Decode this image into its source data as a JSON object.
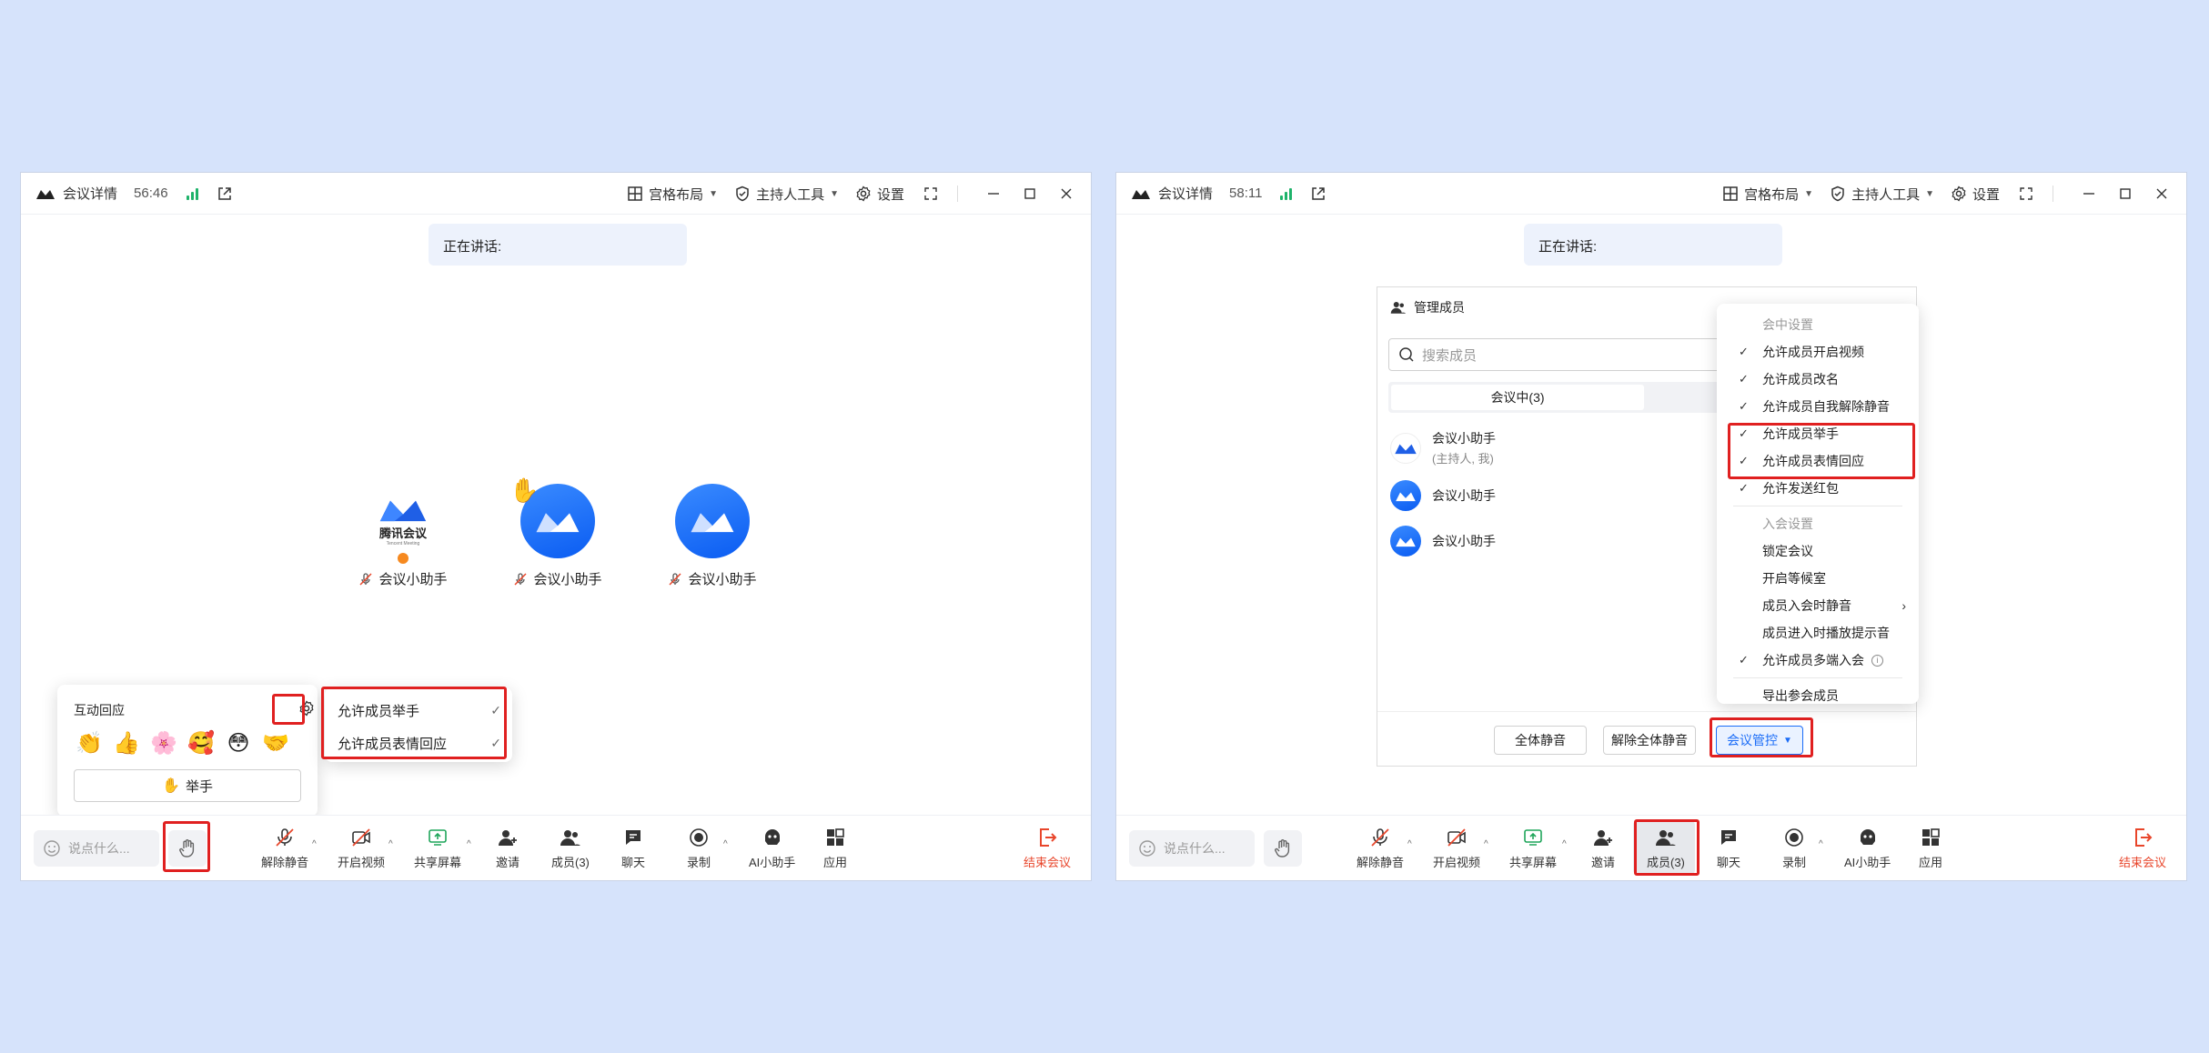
{
  "left": {
    "title": "会议详情",
    "timer": "56:46",
    "grid_layout": "宫格布局",
    "host_tools": "主持人工具",
    "settings": "设置",
    "speaking_label": "正在讲话:",
    "participants": [
      {
        "name": "会议小助手",
        "logo_text": "腾讯会议",
        "logo_sub": "Tencent Meeting"
      },
      {
        "name": "会议小助手"
      },
      {
        "name": "会议小助手"
      }
    ],
    "reactions_title": "互动回应",
    "emojis": [
      "👏",
      "👍",
      "🌸",
      "🥰",
      "😳",
      "🤝"
    ],
    "raise_hand": "举手",
    "settings_menu": [
      "允许成员举手",
      "允许成员表情回应"
    ],
    "chat_placeholder": "说点什么...",
    "toolbar": {
      "unmute": "解除静音",
      "video": "开启视频",
      "share": "共享屏幕",
      "invite": "邀请",
      "members": "成员(3)",
      "chat": "聊天",
      "record": "录制",
      "ai": "AI小助手",
      "apps": "应用",
      "end": "结束会议"
    }
  },
  "right": {
    "title": "会议详情",
    "timer": "58:11",
    "grid_layout": "宫格布局",
    "host_tools": "主持人工具",
    "settings": "设置",
    "speaking_label": "正在讲话:",
    "panel_title": "管理成员",
    "search_placeholder": "搜索成员",
    "tab_in_meeting": "会议中(3)",
    "members": [
      {
        "name": "会议小助手",
        "sub": "(主持人, 我)"
      },
      {
        "name": "会议小助手"
      },
      {
        "name": "会议小助手"
      }
    ],
    "mute_all": "全体静音",
    "unmute_all": "解除全体静音",
    "meeting_control": "会议管控",
    "menu": {
      "in_meeting_header": "会中设置",
      "in_meeting_items": [
        "允许成员开启视频",
        "允许成员改名",
        "允许成员自我解除静音",
        "允许成员举手",
        "允许成员表情回应",
        "允许发送红包"
      ],
      "join_header": "入会设置",
      "join_items": [
        "锁定会议",
        "开启等候室",
        "成员入会时静音",
        "成员进入时播放提示音",
        "允许成员多端入会"
      ],
      "export": "导出参会成员"
    },
    "chat_placeholder": "说点什么...",
    "toolbar": {
      "unmute": "解除静音",
      "video": "开启视频",
      "share": "共享屏幕",
      "invite": "邀请",
      "members": "成员(3)",
      "chat": "聊天",
      "record": "录制",
      "ai": "AI小助手",
      "apps": "应用",
      "end": "结束会议"
    }
  }
}
